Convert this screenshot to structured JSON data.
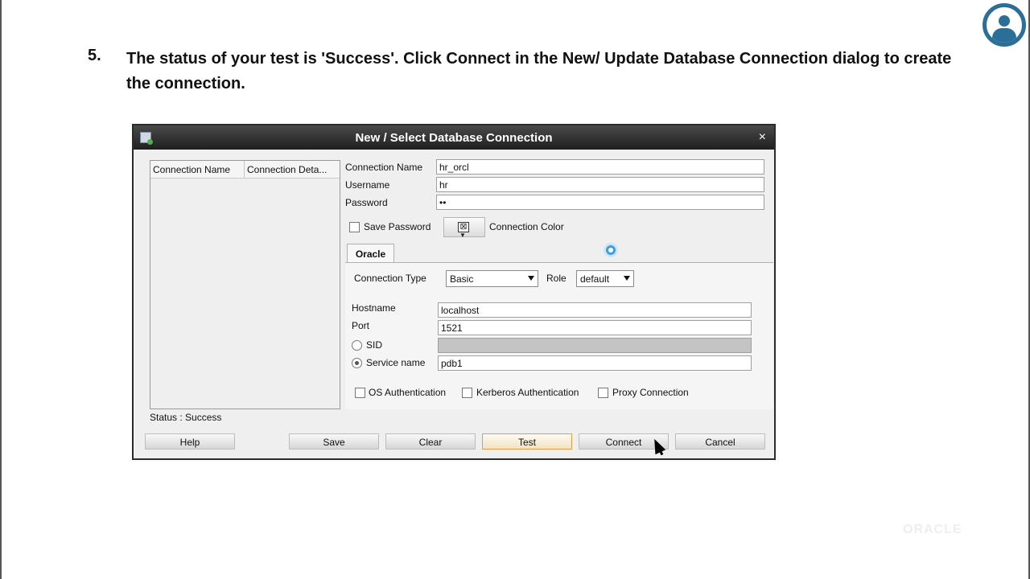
{
  "instruction": {
    "number": "5.",
    "text": "The status of your test is 'Success'. Click Connect in the New/ Update Database Connection dialog to create the connection."
  },
  "dialog": {
    "title": "New / Select Database Connection",
    "close_glyph": "×",
    "list_headers": [
      "Connection Name",
      "Connection Deta..."
    ],
    "fields": {
      "connection_name_label": "Connection Name",
      "connection_name_value": "hr_orcl",
      "username_label": "Username",
      "username_value": "hr",
      "password_label": "Password",
      "password_value": "••"
    },
    "save_password_label": "Save Password",
    "connection_color_label": "Connection Color",
    "color_swatch_glyph": "⊠",
    "tab_label": "Oracle",
    "connection_type_label": "Connection Type",
    "connection_type_value": "Basic",
    "role_label": "Role",
    "role_value": "default",
    "hostname_label": "Hostname",
    "hostname_value": "localhost",
    "port_label": "Port",
    "port_value": "1521",
    "sid_label": "SID",
    "sid_value": "",
    "service_name_label": "Service name",
    "service_name_value": "pdb1",
    "os_auth_label": "OS Authentication",
    "kerberos_auth_label": "Kerberos Authentication",
    "proxy_connection_label": "Proxy Connection",
    "status_text": "Status : Success",
    "buttons": {
      "help": "Help",
      "save": "Save",
      "clear": "Clear",
      "test": "Test",
      "connect": "Connect",
      "cancel": "Cancel"
    }
  },
  "watermark": "ORACLE"
}
